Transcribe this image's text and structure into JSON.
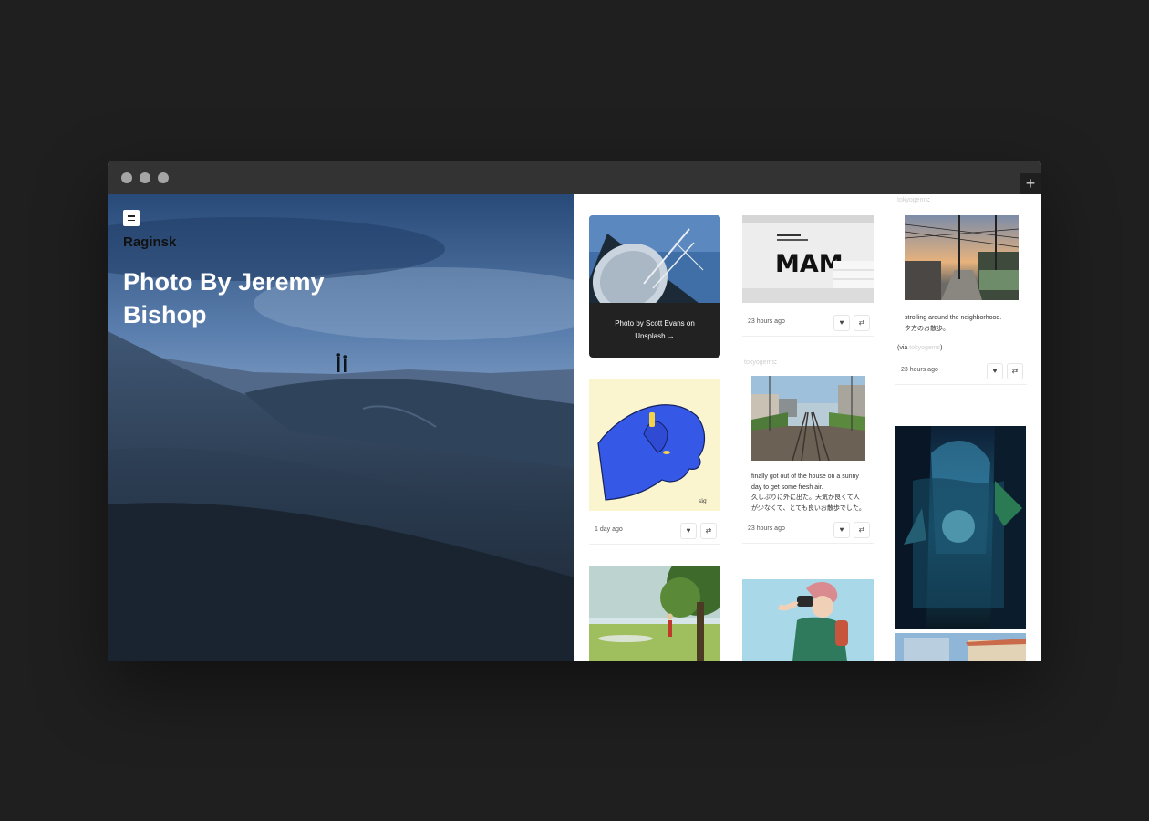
{
  "app": {
    "new_tab_icon": "plus-icon",
    "menu_icon": "hamburger-icon"
  },
  "hero": {
    "site_name": "Raginsk",
    "title": "Photo By Jeremy Bishop"
  },
  "posts": {
    "p1": {
      "credit": "Photo by Scott Evans on Unsplash →"
    },
    "p2": {
      "time": "23 hours ago"
    },
    "p3": {
      "author": "tokyogems",
      "caption_en": "strolling around the neighborhood.",
      "caption_jp": "夕方のお散歩。",
      "via_prefix": "(via ",
      "via_link": "tokyogems",
      "via_suffix": ")",
      "time": "23 hours ago"
    },
    "p4": {
      "time": "1 day ago"
    },
    "p5": {
      "author": "tokyogems",
      "caption_en": "finally got out of the house on a sunny day to get some fresh air.",
      "caption_jp": "久しぶりに外に出た。天気が良くて人が少なくて、とても良いお散歩でした。",
      "time": "23 hours ago"
    }
  },
  "icons": {
    "like": "heart-icon",
    "reblog": "reblog-icon"
  },
  "colors": {
    "hero_sky": "#2c4f7c",
    "dune_dark": "#1e2a38",
    "credit_bg": "#222222",
    "window_bg": "#1f1f1f"
  }
}
